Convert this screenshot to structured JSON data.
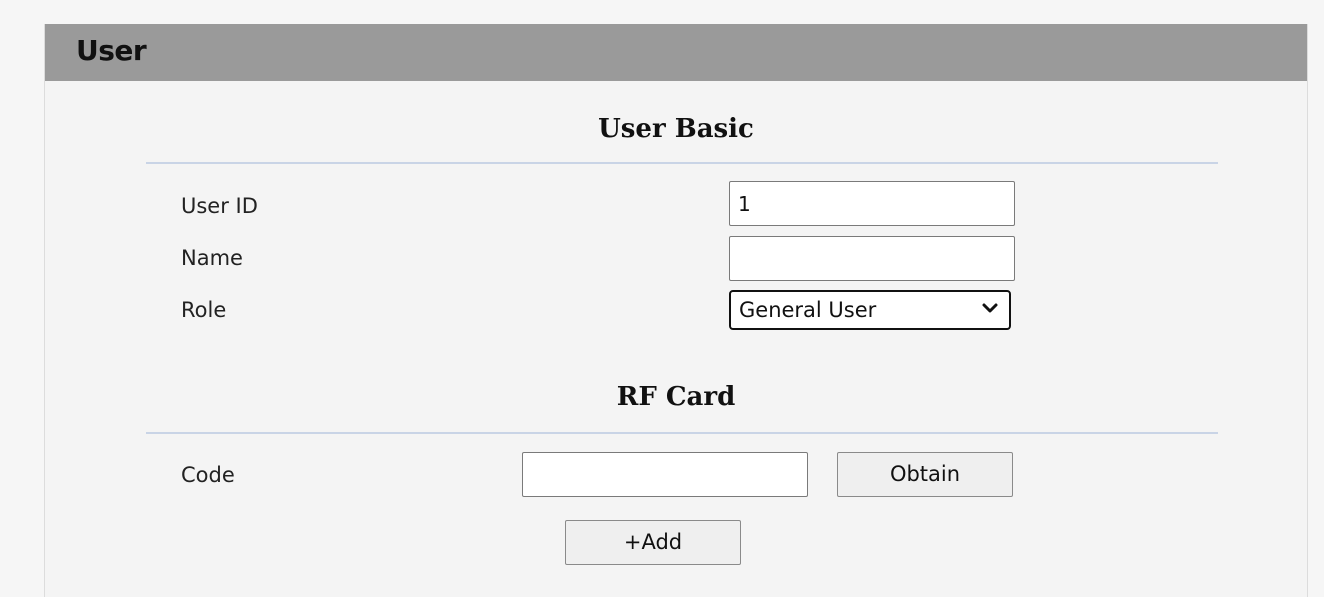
{
  "panel": {
    "title": "User"
  },
  "user_basic": {
    "heading": "User Basic",
    "fields": {
      "user_id": {
        "label": "User ID",
        "value": "1"
      },
      "name": {
        "label": "Name",
        "value": ""
      },
      "role": {
        "label": "Role",
        "selected": "General User"
      }
    }
  },
  "rf_card": {
    "heading": "RF Card",
    "code": {
      "label": "Code",
      "value": ""
    },
    "obtain_label": "Obtain",
    "add_label": "+Add"
  },
  "icons": {
    "role_dropdown": "chevron-down-icon"
  },
  "colors": {
    "header_bg": "#9a9a9a",
    "panel_bg": "#f4f4f4",
    "rule": "#c9d4e6"
  }
}
